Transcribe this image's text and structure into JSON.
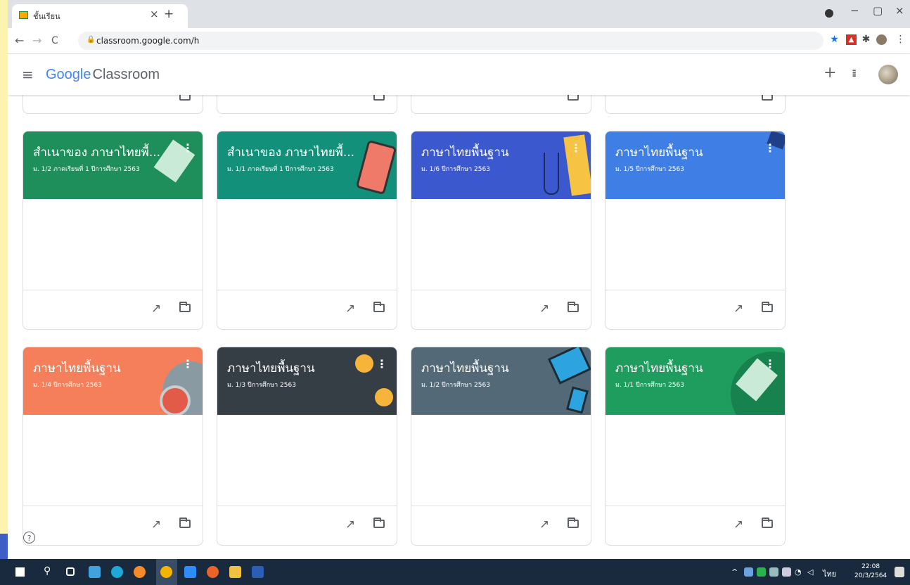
{
  "browser": {
    "tab_title": "ชั้นเรียน",
    "tab_close": "×",
    "new_tab": "+",
    "url": "classroom.google.com/h",
    "back": "←",
    "forward": "→",
    "reload": "C"
  },
  "app": {
    "logo_google": "Google",
    "logo_product": "Classroom",
    "create_icon": "+",
    "apps_icon": "⋮⋮⋮"
  },
  "classes": [
    {
      "title": "สำเนาของ ภาษาไทยพื้...",
      "subtitle": "ม. 1/2 ภาคเรียนที่ 1 ปีการศึกษา 2563",
      "color": "#1e8e5a"
    },
    {
      "title": "สำเนาของ ภาษาไทยพื้...",
      "subtitle": "ม. 1/1 ภาคเรียนที่ 1 ปีการศึกษา 2563",
      "color": "#12907a"
    },
    {
      "title": "ภาษาไทยพื้นฐาน",
      "subtitle": "ม. 1/6 ปีการศึกษา 2563",
      "color": "#3b58cf"
    },
    {
      "title": "ภาษาไทยพื้นฐาน",
      "subtitle": "ม. 1/5 ปีการศึกษา 2563",
      "color": "#3f7fe5"
    },
    {
      "title": "ภาษาไทยพื้นฐาน",
      "subtitle": "ม. 1/4 ปีการศึกษา 2563",
      "color": "#f47f5a"
    },
    {
      "title": "ภาษาไทยพื้นฐาน",
      "subtitle": "ม. 1/3 ปีการศึกษา 2563",
      "color": "#353d45"
    },
    {
      "title": "ภาษาไทยพื้นฐาน",
      "subtitle": "ม. 1/2 ปีการศึกษา 2563",
      "color": "#546977"
    },
    {
      "title": "ภาษาไทยพื้นฐาน",
      "subtitle": "ม. 1/1 ปีการศึกษา 2563",
      "color": "#1f9d5e"
    }
  ],
  "help_icon": "?",
  "taskbar": {
    "language": "ไทย",
    "time": "22:08",
    "date": "20/3/2564"
  }
}
